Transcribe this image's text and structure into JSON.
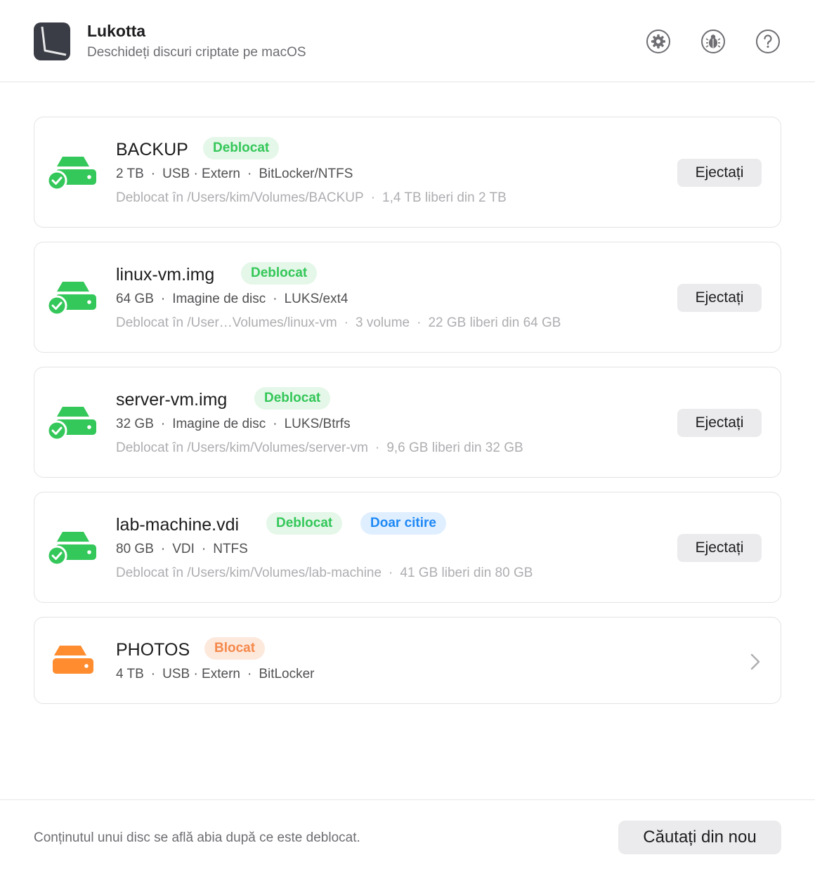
{
  "header": {
    "title": "Lukotta",
    "subtitle": "Deschideți discuri criptate pe macOS",
    "buttons": [
      "gear-icon",
      "bug-icon",
      "help-icon"
    ]
  },
  "colors": {
    "unlocked": "#34c759",
    "locked": "#ff8c2e",
    "readonly": "#1e88f5"
  },
  "disks": [
    {
      "name": "BACKUP",
      "status": "Deblocat",
      "meta": [
        "2 TB",
        "USB · Extern",
        "BitLocker/NTFS"
      ],
      "path": [
        "Deblocat în /Users/kim/Volumes/BACKUP",
        "1,4 TB liberi din 2 TB"
      ],
      "action": "Ejectați"
    },
    {
      "name": "linux-vm.img",
      "status": "Deblocat",
      "meta": [
        "64 GB",
        "Imagine de disc",
        "LUKS/ext4"
      ],
      "path": [
        "Deblocat în /User…Volumes/linux-vm",
        "3 volume",
        "22 GB liberi din 64 GB"
      ],
      "action": "Ejectați"
    },
    {
      "name": "server-vm.img",
      "status": "Deblocat",
      "meta": [
        "32 GB",
        "Imagine de disc",
        "LUKS/Btrfs"
      ],
      "path": [
        "Deblocat în /Users/kim/Volumes/server-vm",
        "9,6 GB liberi din 32 GB"
      ],
      "action": "Ejectați"
    },
    {
      "name": "lab-machine.vdi",
      "status": "Deblocat",
      "extra_badge": "Doar citire",
      "meta": [
        "80 GB",
        "VDI",
        "NTFS"
      ],
      "path": [
        "Deblocat în /Users/kim/Volumes/lab-machine",
        "41 GB liberi din 80 GB"
      ],
      "action": "Ejectați"
    },
    {
      "name": "PHOTOS",
      "status": "Blocat",
      "meta": [
        "4 TB",
        "USB · Extern",
        "BitLocker"
      ]
    }
  ],
  "footer": {
    "note": "Conținutul unui disc se află abia după ce este deblocat.",
    "rescan_label": "Căutați din nou"
  }
}
